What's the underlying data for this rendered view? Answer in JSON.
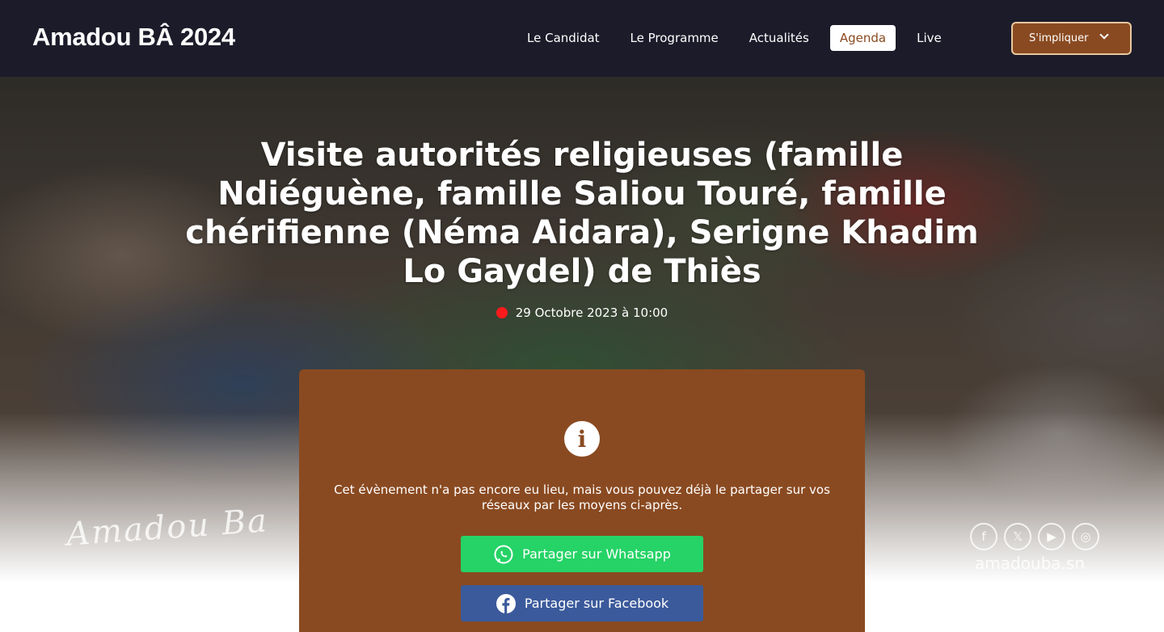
{
  "header": {
    "brand": "Amadou BÂ 2024",
    "nav": [
      {
        "label": "Le Candidat"
      },
      {
        "label": "Le Programme"
      },
      {
        "label": "Actualités"
      },
      {
        "label": "Agenda",
        "active": true
      },
      {
        "label": "Live"
      }
    ],
    "cta_label": "S'impliquer"
  },
  "event": {
    "title": "Visite autorités religieuses (famille Ndiéguène, famille Saliou Touré, famille chérifienne (Néma Aidara), Serigne Khadim Lo Gaydel) de Thiès",
    "date": "29 Octobre 2023 à 10:00"
  },
  "hero": {
    "signature": "Amadou Ba",
    "site_url": "amadouba.sn",
    "social_icons": [
      "facebook-icon",
      "x-icon",
      "youtube-icon",
      "instagram-icon"
    ]
  },
  "card": {
    "notice": "Cet évènement n'a pas encore eu lieu, mais vous pouvez déjà le partager sur vos réseaux par les moyens ci-après.",
    "whatsapp_label": "Partager sur Whatsapp",
    "facebook_label": "Partager sur Facebook"
  },
  "colors": {
    "header_bg": "#1c1b2a",
    "brand_brown": "#8a4a21",
    "whatsapp_green": "#25d366",
    "facebook_blue": "#3b5a9b",
    "live_dot": "#ff1b1b"
  }
}
